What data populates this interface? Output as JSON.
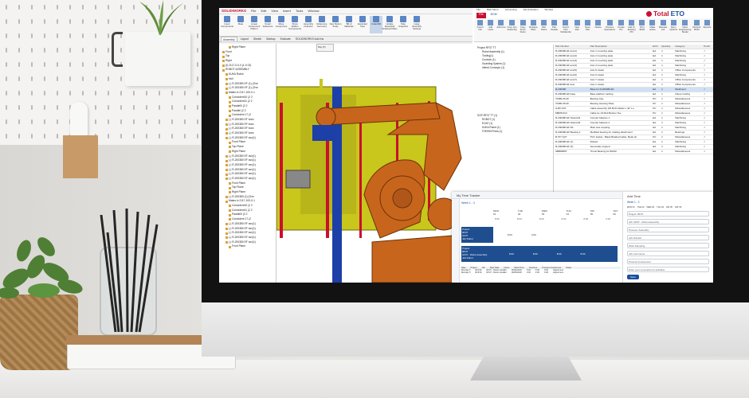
{
  "solidworks": {
    "brand": "SOLIDWORKS",
    "menus": [
      "File",
      "Edit",
      "View",
      "Insert",
      "Tools",
      "Window"
    ],
    "ribbon": [
      "Insert Components",
      "Mate",
      "Linear Component Pattern",
      "Smart Fasteners",
      "Move Component",
      "Show Hidden Components",
      "Assembly Features",
      "Reference Geometry",
      "New Motion Study",
      "Bill of Materials",
      "Exploded View",
      "Instant3D",
      "Update Speedpak Subassemblies",
      "Take Snapshot",
      "Large Assembly Settings"
    ],
    "tabs": [
      "Assembly",
      "Layout",
      "Sketch",
      "Markup",
      "Evaluate",
      "SOLIDWORKS Add-Ins"
    ],
    "active_tab": "Assembly",
    "viewport_toolbar_title": "Top (T)",
    "tree": [
      "Right Plane",
      "Front",
      "Top",
      "Right",
      "(f) 2117-0-0-0 (1-0 02)",
      "ROBOT ASSEMBLY",
      "KUKA Robot",
      "Hull",
      "(-) R-200380 EF (1) (Ove",
      "(-) R-200380 EF (1) (Ove",
      "Mates in 2117-100-0-1",
      "Coincident10 (2 2",
      "Coincident11 (2 2",
      "Parallel0 (2 2",
      "Parallel (2 2",
      "Coincident 17 (2",
      "(-) R-200380 EF boxx",
      "(-) R-200380 EF boxx",
      "(-) R-200380 EF boxx",
      "(-) R-200380 EF boxx",
      "(-) R-200380 EF avx(1)",
      "Front Plane",
      "Top Plane",
      "Right Plane",
      "(-) R-200380 EF avx(1)",
      "(-) R-200380 EF avx(1)",
      "(-) R-200380 EF avx(1)",
      "(-) R-200380 EF avx(1)",
      "(-) R-200380 EF avx(1)",
      "(-) R-200380 EF avx(1)",
      "Front Plane",
      "Top Plane",
      "Right Plane",
      "(-) R-200380 (1) (Ove",
      "Mates in 2117-100-0-1",
      "Coincident10 (2 2",
      "Coincident11 (2 2",
      "Parallel0 (2 2",
      "Coincident 17 (2",
      "(-) R-200380 EF avx(1)",
      "(-) R-200380 EF avx(1)",
      "(-) R-200380 EF avx(1)",
      "(-) R-200380 EF avx(1)",
      "(-) R-200380 EF avx(1)",
      "Front Plane"
    ]
  },
  "planning": {
    "title_tabs": [
      "File",
      "Main Menu",
      "Accounting",
      "Administration",
      "Window"
    ],
    "file_tab": "File",
    "bom_tab": "BOM",
    "logo_text_a": "Total",
    "logo_text_b": "ETO",
    "ribbon": [
      "Import Into",
      "Add Links",
      "Add Line",
      "Copy Into Assembly",
      "Copy Items Down",
      "Replace Parts",
      "Part Notes",
      "Part Details",
      "Import from Solidworks",
      "New Part",
      "Open Part",
      "Delete",
      "Process Operations",
      "Create PO",
      "Add To Existing PO",
      "Print BOM",
      "Make Active",
      "Release Job",
      "Deny Options",
      "Open Engineering Model",
      "Refresh BOM",
      "Reports"
    ],
    "tree": [
      "Project RF37 TT",
      "Robot Assembly (1)",
      "Tooling(1)",
      "Controls (1)",
      "Guarding System (1)",
      "Infeed Conveyor (1)",
      "",
      "",
      "",
      "",
      "",
      "",
      "",
      "",
      "",
      "",
      "",
      "SOP-RF37 TT (1)",
      "ROBOT (1)",
      "EOAT (1)",
      "KUKA Robot (1)",
      "FOREM Prints (1)"
    ],
    "grid_headers": [
      "Part Number",
      "Part Description",
      "ECN",
      "Quantity",
      "Category",
      "Purch"
    ],
    "grid_rows": [
      [
        "R-200380 EF avx(1)",
        "Axis 1 mounting plate",
        "EA",
        "1",
        "Machining",
        "✓"
      ],
      [
        "R-200380 EF avx(2)",
        "Axis 2 mounting plate",
        "EA",
        "1",
        "Machining",
        "✓"
      ],
      [
        "R-200380 EF avx(3)",
        "Axis 3 mounting plate",
        "EA",
        "1",
        "Machining",
        "✓"
      ],
      [
        "R-200380 EF avx(4)",
        "Axis 4 mounting plate",
        "EA",
        "1",
        "Machining",
        "✓"
      ],
      [
        "R-200380 EF avx(5)",
        "Axis 5 rotator",
        "EA",
        "1",
        "Office Components",
        "✓"
      ],
      [
        "R-200380 EF avx(6)",
        "Axis 6 rotator",
        "EA",
        "1",
        "Machining",
        "✓"
      ],
      [
        "R-200380 EF avx(7)",
        "Axis 7 rotator",
        "EA",
        "1",
        "Office Components",
        "✓"
      ],
      [
        "R-200380 EF axis",
        "Axis 1 rotator",
        "EA",
        "1",
        "Office Components",
        "✓"
      ],
      [
        "R-200380",
        "Base for R-200380 EF",
        "EA",
        "1",
        "Weldment",
        "✓"
      ],
      [
        "R-200380 EF base",
        "Base platform casting",
        "EA",
        "1",
        "Flame Cutting",
        "✓"
      ],
      [
        "70480-25-2F",
        "Bearing Cap",
        "PC",
        "1",
        "Miscellaneous",
        "✓"
      ],
      [
        "70480-35-2F",
        "Bearing Housing Plate",
        "PC",
        "1",
        "Miscellaneous",
        "✓"
      ],
      [
        "H-BO 970",
        "Cable assembly 3/8 M10 Cables x 42\" Lo",
        "PC",
        "1",
        "Miscellaneous",
        "✓"
      ],
      [
        "MBKB-510",
        "Cable tie 1/4 Bolt Bottom Tee",
        "PC",
        "1",
        "Miscellaneous",
        "✓"
      ],
      [
        "R-200380 EF Soleroid1",
        "Counter balance 1",
        "EA",
        "1",
        "Machining",
        "✓"
      ],
      [
        "R-200380 EF Soleroid2",
        "Counter balance 2",
        "EA",
        "1",
        "Machining",
        "✓"
      ],
      [
        "R-200380 EF FE",
        "Main axis coupling",
        "EA",
        "1",
        "Machining",
        "✓"
      ],
      [
        "R-200380 EF Bearing 1",
        "Modified bearing for rotating attachment",
        "EA",
        "1",
        "Bearings",
        "✓"
      ],
      [
        "B 077 Q3Y",
        "PVC Jacket - Black Braided Cable, Mylar sh",
        "PC",
        "1",
        "Miscellaneous",
        "✓"
      ],
      [
        "R-200380 EF (1)",
        "Rotator",
        "EA",
        "1",
        "Machining",
        "✓"
      ],
      [
        "R-200380 EF (3)",
        "Secondary support",
        "EA",
        "1",
        "Machining",
        "✓"
      ],
      [
        "SBB9989T",
        "Thrust Bearing for 80x90",
        "EA",
        "1",
        "Miscellaneous",
        "✓"
      ]
    ],
    "selected_row": 8
  },
  "timetracker": {
    "title": "My Time Tracker",
    "week_label": "Week 1 - 3",
    "days": [
      "MON 01",
      "TUE 02",
      "WED 03",
      "THU 04",
      "FRI 05",
      "SAT 06"
    ],
    "totals": [
      "8:00",
      "8:00",
      "8:00",
      "8:00",
      "8:00",
      "0:00"
    ],
    "row1": [
      "Project",
      "RF37",
      "AF37",
      "Job Robot"
    ],
    "row2": [
      "Project",
      "RF37",
      "AF37 - Robot assembly",
      "Job Robot"
    ],
    "row1_values": [
      "8:00",
      "4:00"
    ],
    "row2_values": [
      "8:00",
      "8:00",
      "8:00",
      "8:00"
    ],
    "footer_headers": [
      "Date",
      "Project",
      "Job",
      "Start Date",
      "Hours",
      "Work Time",
      "Overtime",
      "Process Involvement",
      "Notes"
    ],
    "footer_rows": [
      [
        "Monday 5",
        "RF37E",
        "RF37 - Robot Installer",
        "06/04/2020",
        "5:00",
        "5:00",
        "0:00",
        "Adjustment",
        ""
      ],
      [
        "Monday 5",
        "RF37E",
        "RF37 - Robot Installer",
        "06/05/2020",
        "3:00",
        "3:00",
        "0:00",
        "Adjustment",
        ""
      ]
    ],
    "add_panel": {
      "title": "Add Time",
      "week": "Week 1 - 3",
      "days": [
        "MON 01",
        "TUE 02",
        "WED 03",
        "THU 04",
        "FRI 05",
        "SAT 06"
      ],
      "fields": [
        "Project",
        "Job",
        "Process",
        "Job Number",
        "Work Sampling",
        "Job Comments",
        "Process Involvement"
      ],
      "values": [
        "RF37",
        "RF37 - Robot assembly",
        "Assembly",
        "",
        "",
        "",
        ""
      ],
      "note_placeholder": "Enter your comments for activities",
      "save_label": "Save"
    }
  }
}
